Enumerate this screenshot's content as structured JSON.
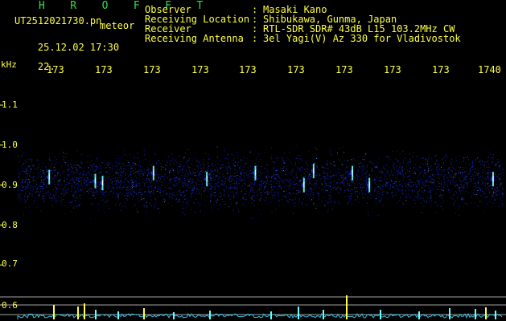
{
  "header": {
    "brand": "HROFFT",
    "file_name": "UT2512021730.pn",
    "kind": "meteor",
    "date_time": "25.12.02 17:30",
    "extra": "22."
  },
  "info": [
    {
      "key": "Observer",
      "value": "Masaki Kano"
    },
    {
      "key": "Receiving Location",
      "value": "Shibukawa, Gunma, Japan"
    },
    {
      "key": "Receiver",
      "value": "RTL-SDR SDR# 43dB L15 103.2MHz CW"
    },
    {
      "key": "Receiving Antenna",
      "value": "3el Yagi(V) Az 330 for Vladivostok"
    }
  ],
  "separator": ":",
  "chart_data": {
    "type": "heatmap",
    "title": "",
    "ylabel": "kHz",
    "x_tick_labels": [
      "173",
      "173",
      "173",
      "173",
      "173",
      "173",
      "173",
      "173",
      "173",
      "1740"
    ],
    "y_ticks": [
      "1.1",
      "1.0",
      "0.9",
      "0.8",
      "0.7",
      "0.6"
    ],
    "band_center_khz": 0.91,
    "meteor_echoes": [
      {
        "x_frac": 0.065,
        "f_khz": 0.92
      },
      {
        "x_frac": 0.16,
        "f_khz": 0.91
      },
      {
        "x_frac": 0.175,
        "f_khz": 0.905
      },
      {
        "x_frac": 0.28,
        "f_khz": 0.93
      },
      {
        "x_frac": 0.39,
        "f_khz": 0.915
      },
      {
        "x_frac": 0.49,
        "f_khz": 0.93
      },
      {
        "x_frac": 0.59,
        "f_khz": 0.9
      },
      {
        "x_frac": 0.61,
        "f_khz": 0.935
      },
      {
        "x_frac": 0.69,
        "f_khz": 0.93
      },
      {
        "x_frac": 0.725,
        "f_khz": 0.9
      },
      {
        "x_frac": 0.98,
        "f_khz": 0.915
      }
    ],
    "colors": {
      "background": "#000000",
      "text": "#ffff44",
      "brand": "#2fe04a",
      "noise": "#1a2bd8",
      "echo": "#66ffff",
      "strong": "#ffff44",
      "guide": "#cfcfcf",
      "spectrum": "#36c3e6"
    }
  }
}
